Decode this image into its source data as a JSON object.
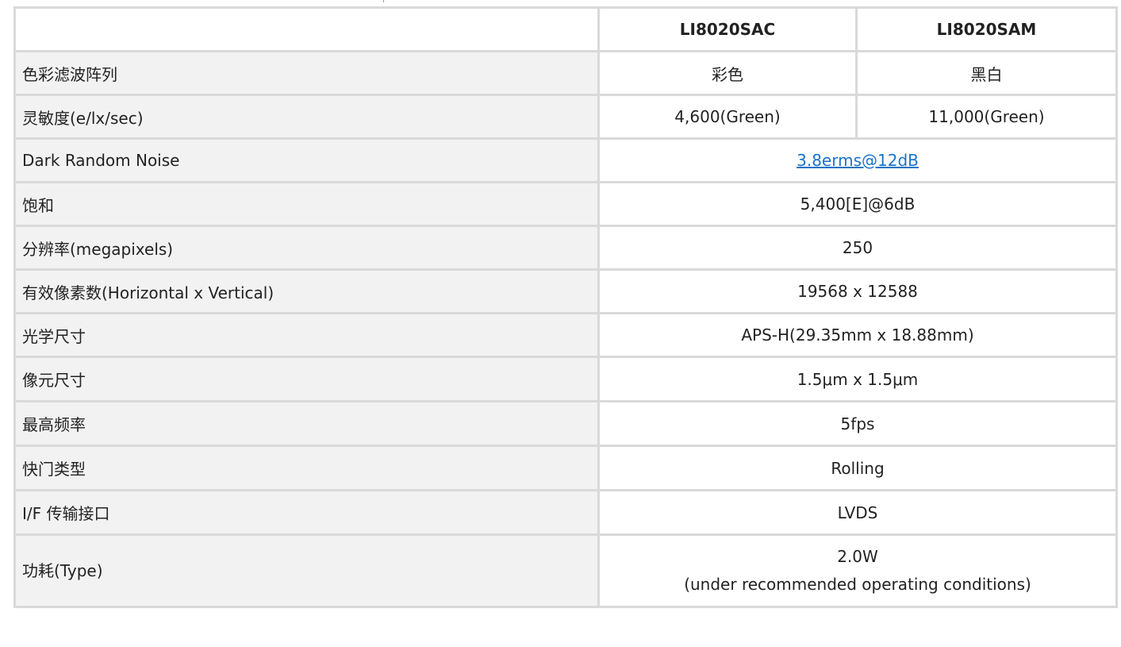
{
  "columns": [
    "",
    "LI8020SAC",
    "LI8020SAM"
  ],
  "rows": [
    {
      "label": "色彩滤波阵列",
      "sac": "彩色",
      "sam": "黑白"
    },
    {
      "label": "灵敏度(e/lx/sec)",
      "sac": "4,600(Green)",
      "sam": "11,000(Green)"
    },
    {
      "label": "Dark Random Noise",
      "value": "3.8erms@12dB"
    },
    {
      "label": "饱和",
      "value": "5,400[E]@6dB"
    },
    {
      "label": "分辨率(megapixels)",
      "value": "250"
    },
    {
      "label": "有效像素数(Horizontal x Vertical)",
      "value": "19568 x 12588"
    },
    {
      "label": "光学尺寸",
      "value": "APS-H(29.35mm x 18.88mm)"
    },
    {
      "label": "像元尺寸",
      "value": "1.5μm x 1.5μm"
    },
    {
      "label": "最高频率",
      "value": "5fps"
    },
    {
      "label": "快门类型",
      "value": "Rolling"
    },
    {
      "label": "I/F 传输接口",
      "value": "LVDS"
    },
    {
      "label": "功耗(Type)",
      "value": "2.0W",
      "value_note": "(under recommended operating conditions)"
    }
  ],
  "colors": {
    "border": "#d9d9d9",
    "label_bg": "#f2f2f2",
    "link": "#1a73c8"
  }
}
